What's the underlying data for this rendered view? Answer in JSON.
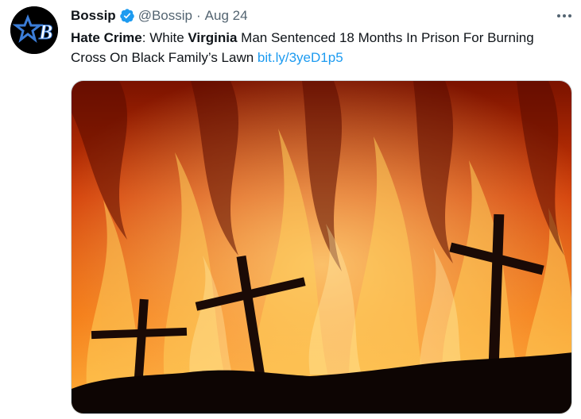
{
  "tweet": {
    "author_name": "Bossip",
    "handle": "@Bossip",
    "separator": "·",
    "date": "Aug 24",
    "avatar_letter": "B",
    "text_parts": [
      {
        "text": "Hate Crime",
        "bold": true
      },
      {
        "text": ": White ",
        "bold": false
      },
      {
        "text": "Virginia",
        "bold": true
      },
      {
        "text": " Man Sentenced 18 Months In Prison For Burning Cross On Black Family’s Lawn ",
        "bold": false
      }
    ],
    "link_text": "bit.ly/3yeD1p5"
  },
  "colors": {
    "link": "#1d9bf0",
    "verified": "#1d9bf0",
    "secondary_text": "#536471"
  },
  "icons": {
    "verified": "verified-badge-icon",
    "more": "more-dots-icon",
    "avatar": "bossip-star-logo"
  }
}
